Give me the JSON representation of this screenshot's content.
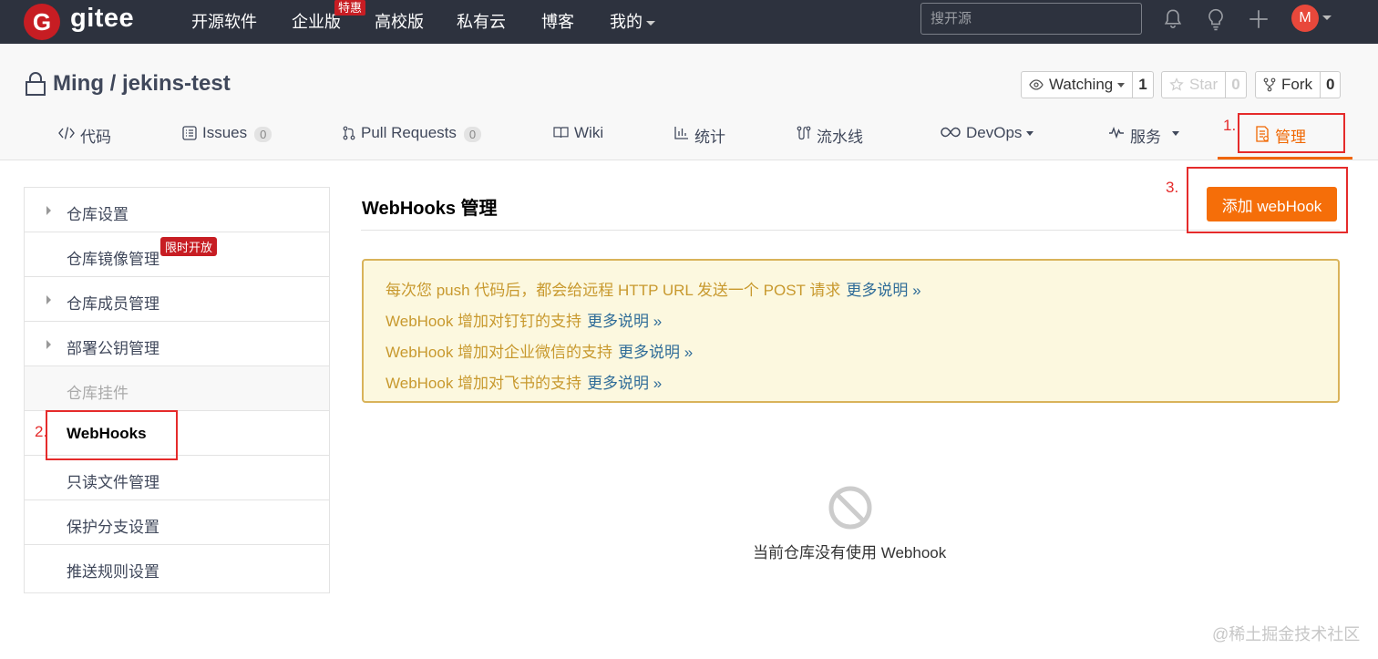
{
  "topbar": {
    "logo_mark": "G",
    "logo_text": "gitee",
    "nav": [
      "开源软件",
      "企业版",
      "高校版",
      "私有云",
      "博客",
      "我的"
    ],
    "enterprise_badge": "特惠",
    "search_placeholder": "搜开源",
    "avatar_initial": "M",
    "icons": [
      "bell-icon",
      "lightbulb-icon",
      "plus-icon"
    ]
  },
  "repo": {
    "title": "Ming / jekins-test",
    "watch_label": "Watching",
    "watch_count": "1",
    "star_label": "Star",
    "star_count": "0",
    "fork_label": "Fork",
    "fork_count": "0"
  },
  "tabs": [
    {
      "label": "代码",
      "icon": "code-icon"
    },
    {
      "label": "Issues",
      "count": "0",
      "icon": "issues-icon"
    },
    {
      "label": "Pull Requests",
      "count": "0",
      "icon": "pull-request-icon"
    },
    {
      "label": "Wiki",
      "icon": "wiki-icon"
    },
    {
      "label": "统计",
      "icon": "chart-icon"
    },
    {
      "label": "流水线",
      "icon": "pipeline-icon"
    },
    {
      "label": "DevOps",
      "icon": "infinity-icon"
    },
    {
      "label": "服务",
      "icon": "pulse-icon"
    },
    {
      "label": "管理",
      "icon": "manage-icon",
      "active": true
    }
  ],
  "sidebar": {
    "items": [
      {
        "label": "仓库设置",
        "arrow": true
      },
      {
        "label": "仓库镜像管理",
        "badge": "限时开放"
      },
      {
        "label": "仓库成员管理",
        "arrow": true
      },
      {
        "label": "部署公钥管理",
        "arrow": true
      },
      {
        "label": "仓库挂件",
        "disabled": true
      },
      {
        "label": "WebHooks",
        "active": true
      },
      {
        "label": "只读文件管理"
      },
      {
        "label": "保护分支设置"
      },
      {
        "label": "推送规则设置"
      }
    ]
  },
  "main": {
    "title": "WebHooks 管理",
    "add_button": "添加 webHook",
    "notices": [
      {
        "text": "每次您 push 代码后，都会给远程 HTTP URL 发送一个 POST 请求",
        "link": "更多说明 »"
      },
      {
        "text": "WebHook 增加对钉钉的支持",
        "link": "更多说明 »"
      },
      {
        "text": "WebHook 增加对企业微信的支持",
        "link": "更多说明 »"
      },
      {
        "text": "WebHook 增加对飞书的支持",
        "link": "更多说明 »"
      }
    ],
    "empty_text": "当前仓库没有使用 Webhook",
    "empty_icon": "no-entry-icon"
  },
  "annotations": [
    "1.",
    "2.",
    "3."
  ],
  "watermark": "@稀土掘金技术社区",
  "colors": {
    "topbar_bg": "#2d323e",
    "brand_red": "#c71d23",
    "accent_orange": "#f06600",
    "button_orange": "#f56e09",
    "notice_bg": "#fcf8df",
    "notice_text": "#c8992e",
    "link_blue": "#2f6c98",
    "annotation_red": "#e52b2b"
  }
}
